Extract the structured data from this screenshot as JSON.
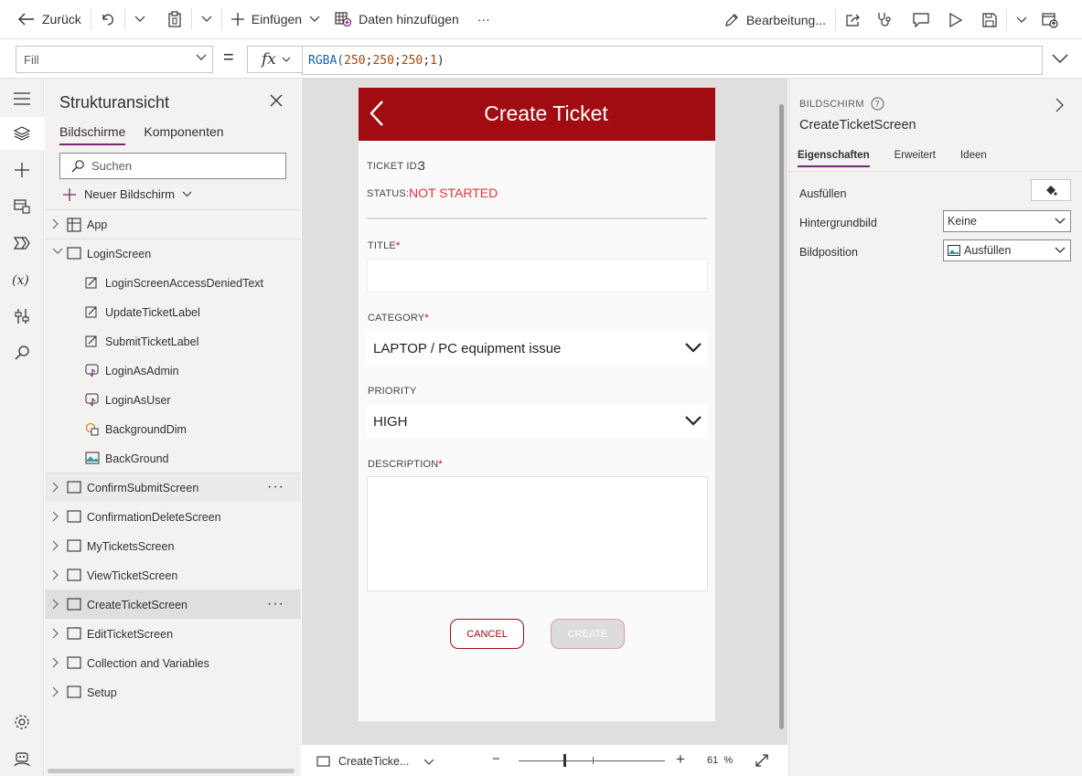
{
  "toolbar": {
    "back_label": "Zurück",
    "insert_label": "Einfügen",
    "add_data_label": "Daten hinzufügen",
    "more_label": "···",
    "edit_label": "Bearbeitung..."
  },
  "formula_bar": {
    "property": "Fill",
    "equals": "=",
    "fx": "fx",
    "formula_fn": "RGBA(",
    "formula_args": [
      "250",
      "250",
      "250",
      "1"
    ],
    "formula_sep": ";",
    "formula_close": ")"
  },
  "tree": {
    "title": "Strukturansicht",
    "tabs": [
      "Bildschirme",
      "Komponenten"
    ],
    "search_placeholder": "Suchen",
    "new_screen_label": "Neuer Bildschirm",
    "items": [
      {
        "label": "App",
        "level": 0
      },
      {
        "label": "LoginScreen",
        "level": 0
      },
      {
        "label": "LoginScreenAccessDeniedText",
        "level": 1
      },
      {
        "label": "UpdateTicketLabel",
        "level": 1
      },
      {
        "label": "SubmitTicketLabel",
        "level": 1
      },
      {
        "label": "LoginAsAdmin",
        "level": 1
      },
      {
        "label": "LoginAsUser",
        "level": 1
      },
      {
        "label": "BackgroundDim",
        "level": 1
      },
      {
        "label": "BackGround",
        "level": 1
      },
      {
        "label": "ConfirmSubmitScreen",
        "level": 0
      },
      {
        "label": "ConfirmationDeleteScreen",
        "level": 0
      },
      {
        "label": "MyTicketsScreen",
        "level": 0
      },
      {
        "label": "ViewTicketScreen",
        "level": 0
      },
      {
        "label": "CreateTicketScreen",
        "level": 0
      },
      {
        "label": "EditTicketScreen",
        "level": 0
      },
      {
        "label": "Collection and Variables",
        "level": 0
      },
      {
        "label": "Setup",
        "level": 0
      }
    ],
    "more": "···"
  },
  "app_screen": {
    "header_title": "Create Ticket",
    "ticket_id_label": "TICKET ID:",
    "ticket_id_value": "3",
    "status_label": "STATUS:",
    "status_value": "NOT STARTED",
    "title_label": "TITLE",
    "category_label": "CATEGORY",
    "category_value": "LAPTOP / PC equipment issue",
    "priority_label": "PRIORITY",
    "priority_value": "HIGH",
    "description_label": "DESCRIPTION",
    "required_mark": "*",
    "cancel_label": "CANCEL",
    "create_label": "CREATE",
    "colors": {
      "header": "#a10c12",
      "status": "#e3343f",
      "background": "#fafafa"
    }
  },
  "canvas_bar": {
    "screen_name": "CreateTicke...",
    "zoom_value": "61",
    "zoom_unit": "%",
    "zoom_minus": "−",
    "zoom_plus": "+"
  },
  "properties": {
    "kind_label": "BILDSCHIRM",
    "screen_name": "CreateTicketScreen",
    "tabs": [
      "Eigenschaften",
      "Erweitert",
      "Ideen"
    ],
    "fill_label": "Ausfüllen",
    "bg_image_label": "Hintergrundbild",
    "bg_image_value": "Keine",
    "image_position_label": "Bildposition",
    "image_position_value": "Ausfüllen"
  }
}
